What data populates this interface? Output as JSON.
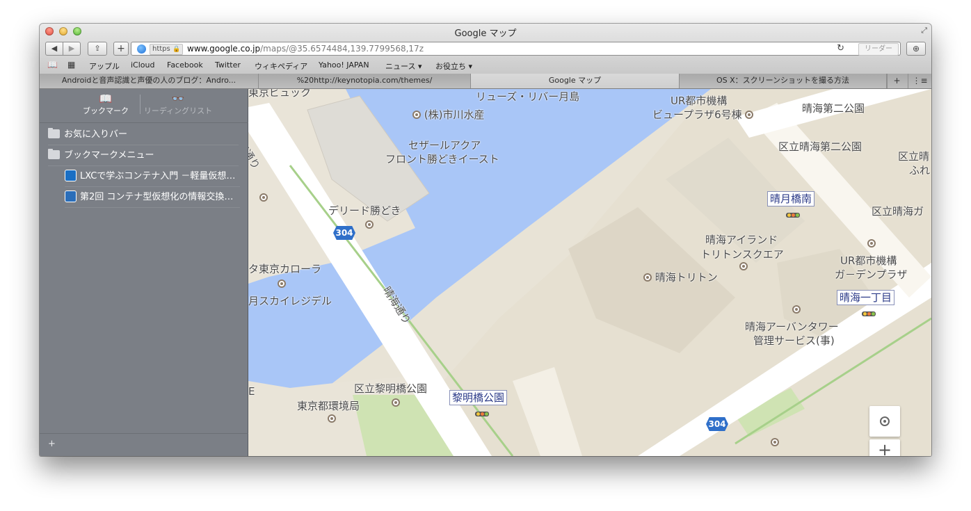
{
  "window": {
    "title": "Google マップ",
    "fullscreen_icon": "fullscreen-arrows-icon"
  },
  "toolbar": {
    "back_glyph": "◀",
    "forward_glyph": "▶",
    "share_glyph": "⇪",
    "add_glyph": "+",
    "https_badge": "https",
    "url_host": "www.google.co.jp",
    "url_path": "/maps/@35.6574484,139.7799568,17z",
    "reload_glyph": "↻",
    "reader_label": "リーダー",
    "download_glyph": "⊕"
  },
  "bookmarks_bar": {
    "reading_glyph": "📖",
    "grid_glyph": "▦",
    "items": [
      "アップル",
      "iCloud",
      "Facebook",
      "Twitter",
      "ウィキペディア",
      "Yahoo! JAPAN",
      "ニュース ▾",
      "お役立ち ▾"
    ]
  },
  "tabs": [
    {
      "label": "Androidと音声認識と声優の人のブログ：Andro...",
      "active": false
    },
    {
      "label": "%20http://keynotopia.com/themes/",
      "active": false
    },
    {
      "label": "Google マップ",
      "active": true
    },
    {
      "label": "OS X：スクリーンショットを撮る方法",
      "active": false
    }
  ],
  "tab_controls": {
    "new_tab": "+",
    "show_all": "⋮≡"
  },
  "sidebar": {
    "bookmarks_label": "ブックマーク",
    "bookmarks_glyph": "📖",
    "reading_label": "リーディングリスト",
    "reading_glyph": "👓",
    "folders": [
      {
        "label": "お気に入りバー"
      },
      {
        "label": "ブックマークメニュー"
      }
    ],
    "links": [
      {
        "label": "LXCで学ぶコンテナ入門 －軽量仮想…"
      },
      {
        "label": "第2回 コンテナ型仮想化の情報交換…"
      }
    ],
    "add_glyph": "+"
  },
  "map": {
    "labels": {
      "tokyo_big": "東京ビュック",
      "river": "リューズ・リバー月島",
      "ur_1": "UR都市機構",
      "ur_2": "ビュープラザ6号棟",
      "harumi_park2": "晴海第二公園",
      "ichikawa": "(株)市川水産",
      "sezar_1": "セザールアクア",
      "sezar_2": "フロント勝どきイースト",
      "kuritsu_park2": "区立晴海第二公園",
      "kuritsu_edge_1": "区立晴",
      "kuritsu_edge_2": "ふれ",
      "dorido": "デリード勝どき",
      "harumi_dori_top": "海通り",
      "station_tsukihashi": "晴月橋南",
      "kuritsu_harumi_ga": "区立晴海ガ",
      "island_1": "晴海アイランド",
      "island_2": "トリトンスクエア",
      "ur_garden_1": "UR都市機構",
      "ur_garden_2": "ガ－デンプラザ",
      "toyota": "タ東京カローラ",
      "triton": "晴海トリトン",
      "station_itchome": "晴海一丁目",
      "skyresi": "月スカイレジデル",
      "harumi_dori": "晴海通り",
      "urban_1": "晴海アーバンタワー",
      "urban_2": "管理サービス(事)",
      "reimei_park": "区立黎明橋公園",
      "station_reimei": "黎明橋公園",
      "kankyo": "東京都環境局",
      "route_304": "304",
      "edge_e": "E"
    },
    "zoom_in_glyph": "+",
    "colors": {
      "water": "#a9c6f7",
      "land": "#e8e3d6",
      "road": "#ffffff",
      "park": "#cfe3b3",
      "route_shield": "#2f6fc9"
    }
  }
}
